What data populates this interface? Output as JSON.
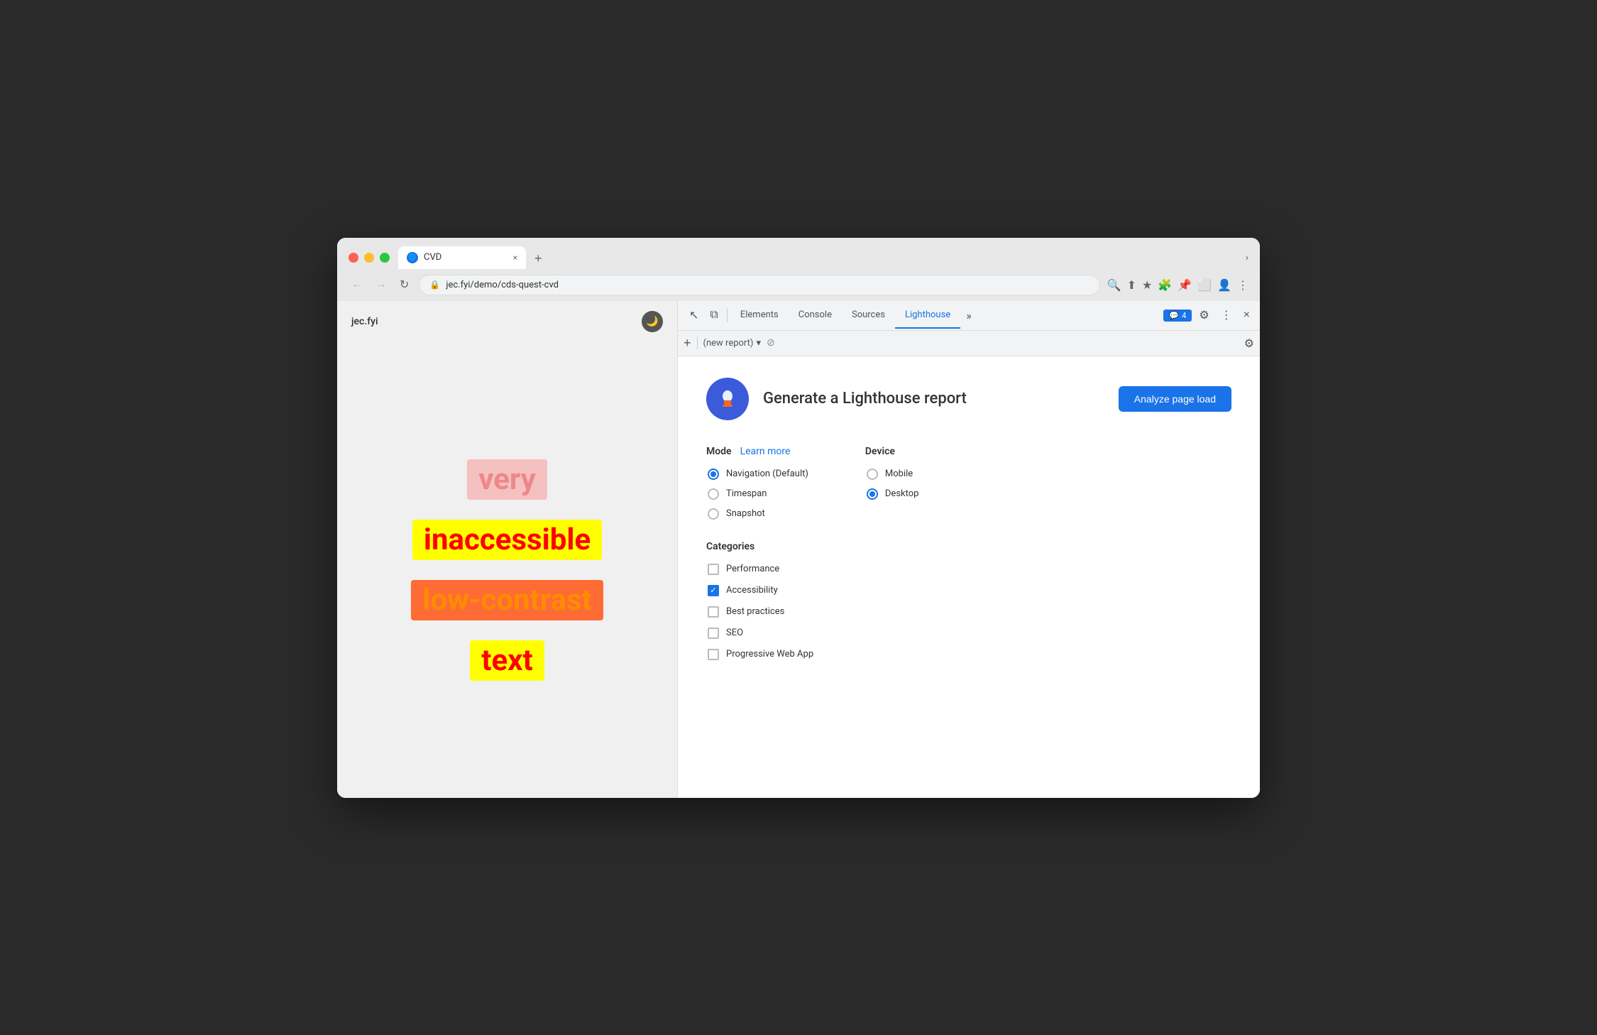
{
  "browser": {
    "traffic_lights": [
      "red",
      "yellow",
      "green"
    ],
    "tab": {
      "favicon": "🌐",
      "title": "CVD",
      "close": "×"
    },
    "new_tab": "+",
    "tab_more": "›",
    "nav": {
      "back": "←",
      "forward": "→",
      "reload": "↻",
      "url": "jec.fyi/demo/cds-quest-cvd",
      "lock_icon": "🔒"
    },
    "nav_icons": [
      "🔍",
      "⬆",
      "★",
      "🧩",
      "📌",
      "⬜",
      "👤",
      "⋮"
    ]
  },
  "webpage": {
    "title": "jec.fyi",
    "dark_mode_icon": "🌙",
    "demo_words": [
      {
        "text": "very",
        "class": "demo-text-very"
      },
      {
        "text": "inaccessible",
        "class": "demo-text-inaccessible"
      },
      {
        "text": "low-contrast",
        "class": "demo-text-lowcontrast"
      },
      {
        "text": "text",
        "class": "demo-text-text"
      }
    ]
  },
  "devtools": {
    "toolbar": {
      "inspect_icon": "↖",
      "device_icon": "⧉",
      "tabs": [
        "Elements",
        "Console",
        "Sources",
        "Lighthouse"
      ],
      "active_tab": "Lighthouse",
      "more_tabs": "»",
      "badge_count": "4",
      "settings_icon": "⚙",
      "more_icon": "⋮",
      "close_icon": "×"
    },
    "secondary": {
      "add_icon": "+",
      "report_placeholder": "(new report)",
      "dropdown_icon": "▾",
      "no_icon": "⊘",
      "settings_icon": "⚙"
    },
    "lighthouse": {
      "logo": "🏠",
      "title": "Generate a Lighthouse report",
      "analyze_btn": "Analyze page load",
      "mode_label": "Mode",
      "learn_more": "Learn more",
      "modes": [
        {
          "label": "Navigation (Default)",
          "checked": true
        },
        {
          "label": "Timespan",
          "checked": false
        },
        {
          "label": "Snapshot",
          "checked": false
        }
      ],
      "device_label": "Device",
      "devices": [
        {
          "label": "Mobile",
          "checked": false
        },
        {
          "label": "Desktop",
          "checked": true
        }
      ],
      "categories_label": "Categories",
      "categories": [
        {
          "label": "Performance",
          "checked": false
        },
        {
          "label": "Accessibility",
          "checked": true
        },
        {
          "label": "Best practices",
          "checked": false
        },
        {
          "label": "SEO",
          "checked": false
        },
        {
          "label": "Progressive Web App",
          "checked": false
        }
      ]
    }
  }
}
